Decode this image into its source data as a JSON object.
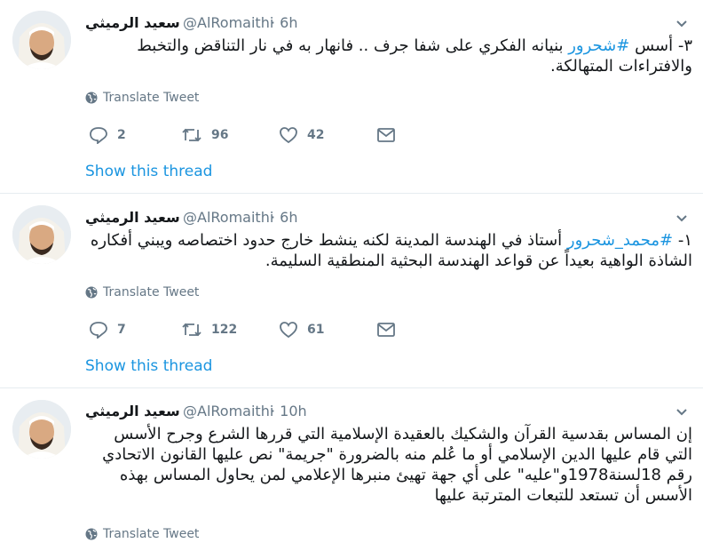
{
  "tweets": [
    {
      "name": "سعيد الرميثي",
      "handle": "@AlRomaithi",
      "time": "· 6h",
      "prefix": "٣- أسس ",
      "hashtag": "#شحرور",
      "text": " بنيانه الفكري على شفا جرف .. فانهار به في نار التناقض والتخبط والافتراءات المتهالكة.",
      "translate": "Translate Tweet",
      "replies": "2",
      "retweets": "96",
      "likes": "42",
      "show_thread": "Show this thread"
    },
    {
      "name": "سعيد الرميثي",
      "handle": "@AlRomaithi",
      "time": "· 6h",
      "prefix": "١- ",
      "hashtag": "#محمد_شحرور",
      "text": " أستاذ في الهندسة المدينة لكنه ينشط خارج حدود اختصاصه ويبني أفكاره الشاذة الواهية بعيداً عن قواعد الهندسة البحثية المنطقية السليمة.",
      "translate": "Translate Tweet",
      "replies": "7",
      "retweets": "122",
      "likes": "61",
      "show_thread": "Show this thread"
    },
    {
      "name": "سعيد الرميثي",
      "handle": "@AlRomaithi",
      "time": "· 10h",
      "prefix": "",
      "hashtag": "",
      "text": "إن المساس بقدسية القرآن والشكيك بالعقيدة الإسلامية التي قررها الشرع وجرح الأسس التي قام عليها الدين الإسلامي أو ما عُلم منه بالضرورة \"جريمة\" نص عليها القانون الاتحادي رقم 18لسنة1978و\"عليه\" على أي جهة تهيئ منبرها الإعلامي لمن يحاول المساس بهذه الأسس أن تستعد للتبعات المترتبة عليها",
      "translate": "Translate Tweet"
    }
  ],
  "colors": {
    "accent": "#1b95e0",
    "muted": "#657786",
    "text": "#14171a",
    "divider": "#e6ecf0"
  },
  "icons": [
    "chevron-down-icon",
    "globe-icon",
    "reply-icon",
    "retweet-icon",
    "like-icon",
    "message-icon"
  ]
}
